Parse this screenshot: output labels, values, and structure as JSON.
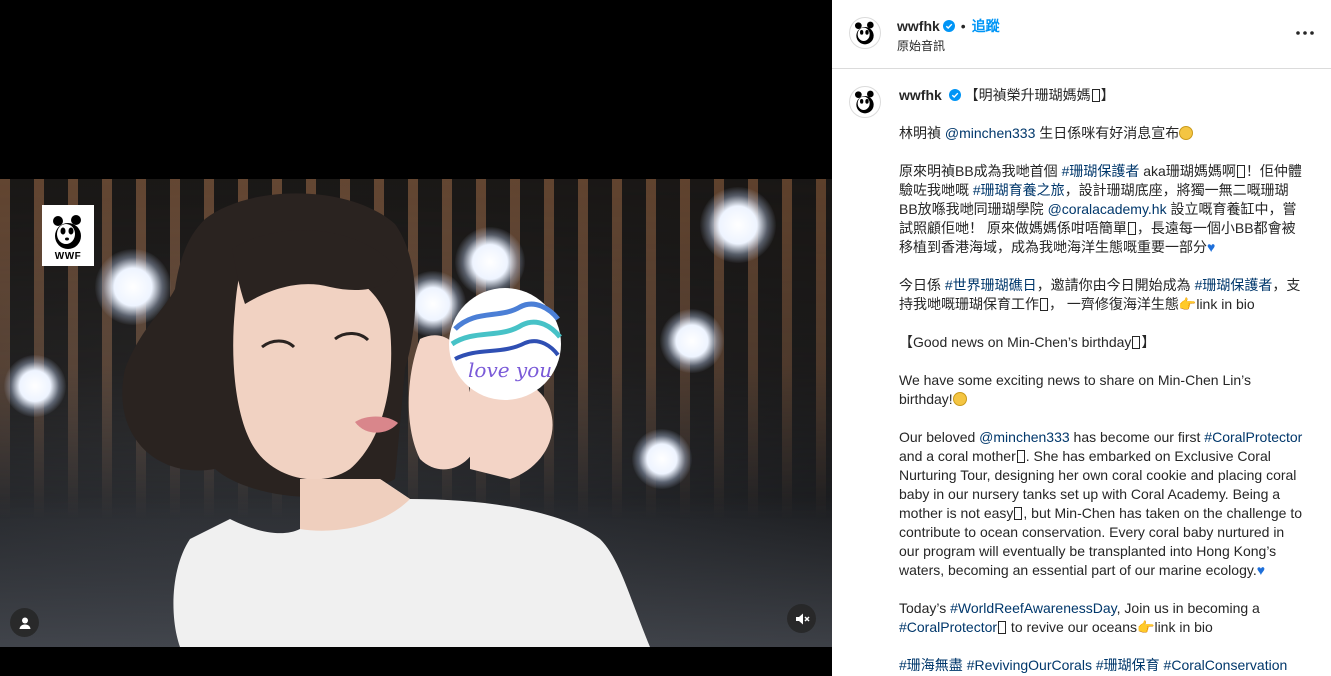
{
  "post": {
    "author": "wwfhk",
    "follow_label": "追蹤",
    "separator": "•",
    "audio_label": "原始音訊",
    "more_label": "…"
  },
  "media": {
    "badge_text": "WWF",
    "card_text": "love you"
  },
  "caption": {
    "title": "【明禎榮升珊瑚媽媽",
    "title_end": "】",
    "p1": {
      "pre": "林明禎 ",
      "mention": "@minchen333",
      "post": " 生日係咪有好消息宣布"
    },
    "p2": {
      "t1": "原來明禎BB成為我哋首個 ",
      "tag1": "#珊瑚保護者",
      "t2": " aka珊瑚媽媽啊",
      "t3": "！佢仲體驗咗我哋嘅 ",
      "tag2": "#珊瑚育養之旅",
      "t4": "，設計珊瑚底座，將獨一無二嘅珊瑚BB放喺我哋同珊瑚學院 ",
      "mention": "@coralacademy.hk",
      "t5": " 設立嘅育養缸中，嘗試照顧佢哋！ 原來做媽媽係咁唔簡單",
      "t6": "，長遠每一個小BB都會被移植到香港海域，成為我哋海洋生態嘅重要一部分"
    },
    "p3": {
      "t1": "今日係 ",
      "tag1": "#世界珊瑚礁日",
      "t2": "，邀請你由今日開始成為 ",
      "tag2": "#珊瑚保護者",
      "t3": "，支持我哋嘅珊瑚保育工作",
      "t4": "， 一齊修復海洋生態",
      "t5": "link in bio"
    },
    "p4": {
      "t1": "【Good news on Min-Chen’s birthday",
      "t2": "】"
    },
    "p5": {
      "t1": "We have some exciting news to share on Min-Chen Lin’s birthday!"
    },
    "p6": {
      "t1": "Our beloved ",
      "mention": "@minchen333",
      "t2": " has become our first ",
      "tag1": "#CoralProtector",
      "t3": " and a coral mother",
      "t4": ". She has embarked on Exclusive Coral Nurturing Tour, designing her own coral cookie and placing coral baby in our nursery tanks set up with Coral Academy. Being a mother is not easy",
      "t5": ", but Min-Chen has taken on the challenge to contribute to ocean conservation. Every coral baby nurtured in our program will eventually be transplanted into Hong Kong’s waters, becoming an essential part of our marine ecology."
    },
    "p7": {
      "t1": "Today’s ",
      "tag1": "#WorldReefAwarenessDay",
      "t2": ", Join us in becoming a ",
      "tag2": "#CoralProtector",
      "t3": " to revive our oceans",
      "t4": "link in bio"
    },
    "p8": {
      "tag1": "#珊海無盡",
      "tag2": "#RevivingOurCorals",
      "tag3": "#珊瑚保育",
      "tag4": "#CoralConservation"
    }
  },
  "icons": {
    "verified": "verified-badge-icon",
    "more": "more-horizontal-icon",
    "user_tag": "user-tag-icon",
    "mute": "speaker-muted-icon",
    "heart": "blue-heart-icon",
    "point": "pointing-hand-icon",
    "smile": "smiling-face-icon"
  },
  "colors": {
    "link": "#00376b",
    "follow": "#0095f6",
    "verified": "#0095f6",
    "text": "#262626"
  }
}
